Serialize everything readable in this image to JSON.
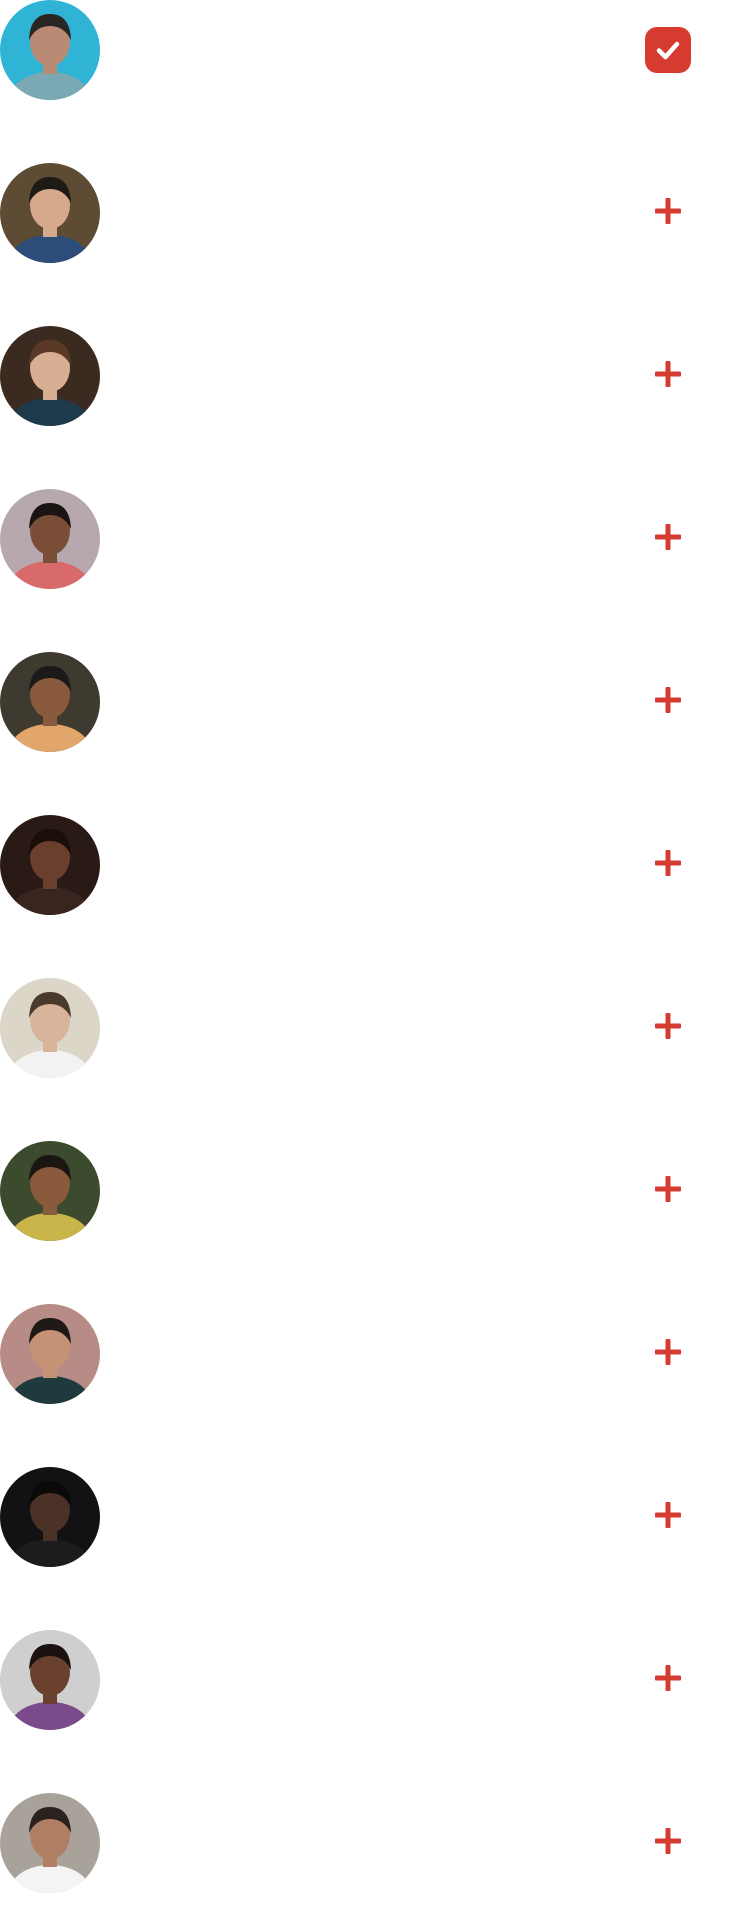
{
  "accent_color": "#D63B30",
  "people": [
    {
      "selected": true,
      "avatar": "avatar-man-underwater",
      "bg": "#2FB4D6",
      "skin": "#B98B74",
      "hair": "#2A2623",
      "cloth": "#7AA8B3"
    },
    {
      "selected": false,
      "avatar": "avatar-man-in-blue-suit",
      "bg": "#5E4B33",
      "skin": "#D6A98C",
      "hair": "#1E1A16",
      "cloth": "#2C4C7A"
    },
    {
      "selected": false,
      "avatar": "avatar-woman-long-hair",
      "bg": "#3B2A20",
      "skin": "#D9AF93",
      "hair": "#5A3A26",
      "cloth": "#1F3A4A"
    },
    {
      "selected": false,
      "avatar": "avatar-woman-smiling-curly-hair",
      "bg": "#B7A8B0",
      "skin": "#7A4E36",
      "hair": "#1A1412",
      "cloth": "#D96A6A"
    },
    {
      "selected": false,
      "avatar": "avatar-woman-holding-glitter",
      "bg": "#3E3A2F",
      "skin": "#8A5A3E",
      "hair": "#1C1A18",
      "cloth": "#E2A66A"
    },
    {
      "selected": false,
      "avatar": "avatar-woman-dark-curly-hair",
      "bg": "#2A1A16",
      "skin": "#6B3F2D",
      "hair": "#1A0E0B",
      "cloth": "#3A2420"
    },
    {
      "selected": false,
      "avatar": "avatar-man-sunglasses-laughing",
      "bg": "#DCD6C8",
      "skin": "#D8B49A",
      "hair": "#4A3A2E",
      "cloth": "#F2F2F2"
    },
    {
      "selected": false,
      "avatar": "avatar-man-subway",
      "bg": "#3C4A2E",
      "skin": "#8A5A3C",
      "hair": "#1B1612",
      "cloth": "#C9B54A"
    },
    {
      "selected": false,
      "avatar": "avatar-man-glasses-beard",
      "bg": "#B88C86",
      "skin": "#C69276",
      "hair": "#1F1A17",
      "cloth": "#1E3A3C"
    },
    {
      "selected": false,
      "avatar": "avatar-man-dark-portrait",
      "bg": "#121214",
      "skin": "#4A3226",
      "hair": "#0C0A09",
      "cloth": "#1C1C1E"
    },
    {
      "selected": false,
      "avatar": "avatar-woman-glasses-braids",
      "bg": "#CFCFCF",
      "skin": "#6A412E",
      "hair": "#1A1210",
      "cloth": "#7A4A8A"
    },
    {
      "selected": false,
      "avatar": "avatar-man-big-guy-tshirt",
      "bg": "#A9A29A",
      "skin": "#B07E62",
      "hair": "#2A221E",
      "cloth": "#F4F4F4"
    }
  ]
}
